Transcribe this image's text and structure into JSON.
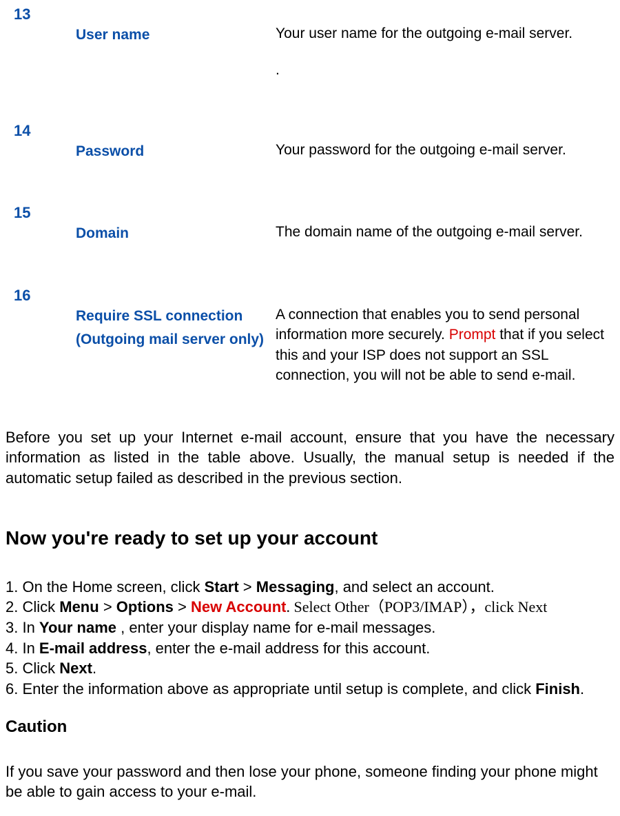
{
  "rows": [
    {
      "num": "13",
      "term": "User name",
      "desc": "Your user name for the outgoing e-mail server.",
      "extra_period": "."
    },
    {
      "num": "14",
      "term": "Password",
      "desc": "Your password for the outgoing e-mail server."
    },
    {
      "num": "15",
      "term": "Domain",
      "desc": "The domain name of the outgoing e-mail server."
    },
    {
      "num": "16",
      "term": "Require SSL connection (Outgoing mail server only)",
      "desc_pre": "A connection that enables you to send personal information more securely. ",
      "desc_red": "Prompt",
      "desc_post": " that if you select this and your ISP does not support an SSL connection, you will not be able to send e-mail."
    }
  ],
  "intro": "Before you set up your Internet e-mail account, ensure that you have the necessary information as listed in the table above. Usually, the manual setup is needed if the automatic setup failed as described in the previous section.",
  "heading": "Now you're ready to set up your account",
  "steps": {
    "s1_a": "1. On the Home screen, click ",
    "s1_b": "Start",
    "s1_c": " > ",
    "s1_d": "Messaging",
    "s1_e": ", and select an account.",
    "s2_a": "2. Click ",
    "s2_b": "Menu",
    "s2_c": " > ",
    "s2_d": "Options",
    "s2_e": " > ",
    "s2_f": "New Account",
    "s2_g": ". ",
    "s2_h": "Select Other（POP3/IMAP），click Next",
    "s3_a": "3. In ",
    "s3_b": "Your name",
    "s3_c": " , enter your display name for e-mail messages.",
    "s4_a": "4. In ",
    "s4_b": "E-mail address",
    "s4_c": ", enter the e-mail address for this account.",
    "s5_a": "5. Click ",
    "s5_b": "Next",
    "s5_c": ".",
    "s6_a": "6. Enter the information above as appropriate until setup is complete, and click ",
    "s6_b": "Finish",
    "s6_c": "."
  },
  "caution_heading": "Caution",
  "caution_text": "If you save your password and then lose your phone, someone finding your phone might be able to gain access to your e-mail."
}
